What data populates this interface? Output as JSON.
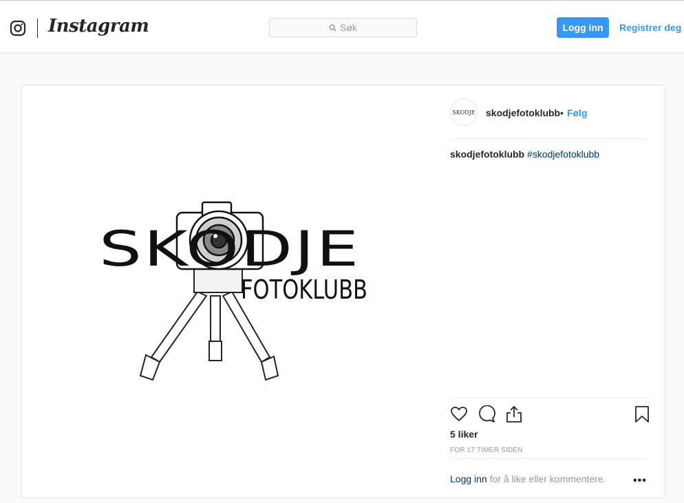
{
  "header": {
    "wordmark": "Instagram",
    "search_placeholder": "Søk",
    "login_label": "Logg inn",
    "register_label": "Registrer deg"
  },
  "post": {
    "image_text": {
      "line1": "SKODJE",
      "line2": "FOTOKLUBB"
    },
    "username": "skodjefotoklubb",
    "separator": "•",
    "follow_label": "Følg",
    "avatar_text": "SKODJE",
    "caption": {
      "username": "skodjefotoklubb",
      "hashtag": "#skodjefotoklubb"
    },
    "likes": "5 liker",
    "timestamp": "FOR 17 TIMER SIDEN",
    "login_prompt": {
      "link": "Logg inn",
      "text": " for å like eller kommentere."
    },
    "more_label": "•••"
  },
  "icons": [
    "instagram-camera-icon",
    "search-icon",
    "heart-icon",
    "comment-icon",
    "share-icon",
    "bookmark-icon",
    "more-options-icon"
  ],
  "colors": {
    "accent": "#3897f0",
    "link_dark": "#003569",
    "text": "#262626",
    "muted": "#999999"
  }
}
